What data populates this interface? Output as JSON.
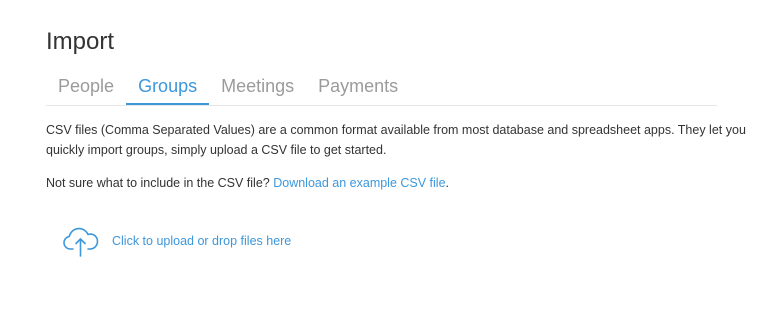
{
  "page": {
    "title": "Import"
  },
  "tabs": [
    {
      "label": "People",
      "active": false
    },
    {
      "label": "Groups",
      "active": true
    },
    {
      "label": "Meetings",
      "active": false
    },
    {
      "label": "Payments",
      "active": false
    }
  ],
  "content": {
    "description": "CSV files (Comma Separated Values) are a common format available from most database and spreadsheet apps. They let you quickly import groups, simply upload a CSV file to get started.",
    "hint_text": "Not sure what to include in the CSV file?",
    "hint_link": "Download an example CSV file",
    "hint_suffix": "."
  },
  "upload": {
    "icon": "cloud-upload-icon",
    "label": "Click to upload or drop files here"
  },
  "colors": {
    "accent": "#3d97db",
    "text": "#333333",
    "muted": "#9b9b9b",
    "divider": "#e6e6e6"
  }
}
